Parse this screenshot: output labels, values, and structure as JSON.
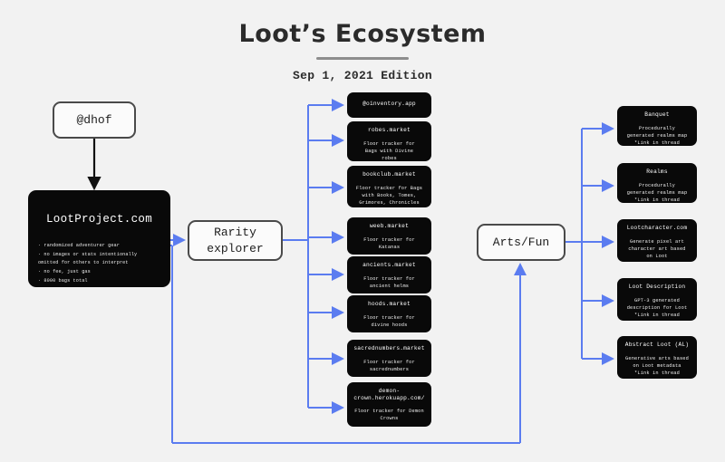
{
  "header": {
    "title": "Loot’s Ecosystem",
    "subtitle": "Sep 1, 2021 Edition"
  },
  "colors": {
    "background": "#f2f2f2",
    "node_dark": "#090909",
    "node_light": "#fbfbfb",
    "wire": "#5b7cf0",
    "arrow_black": "#111111",
    "rule": "#8d8d8d"
  },
  "nodes": {
    "author": {
      "label": "@dhof"
    },
    "loot_project": {
      "title": "LootProject.com",
      "bullets": "· randomized adventurer gear\n· no images or stats intentionally\n  omitted for others to interpret\n· no fee, just gas\n· 8000 bags total"
    },
    "rarity_explorer": {
      "label": "Rarity\nexplorer"
    },
    "arts_fun": {
      "label": "Arts/Fun"
    }
  },
  "rarity_children": [
    {
      "title": "@oinventory.app",
      "desc": ""
    },
    {
      "title": "robes.market",
      "desc": "Floor tracker for\nBags with Divine\nrobes"
    },
    {
      "title": "bookclub.market",
      "desc": "Floor tracker for Bags\nwith Books, Tomes,\nGrimores, Chronicles"
    },
    {
      "title": "weeb.market",
      "desc": "Floor tracker for\nKatanas"
    },
    {
      "title": "ancients.market",
      "desc": "Floor tracker for\nancient helms"
    },
    {
      "title": "hoods.market",
      "desc": "Floor tracker for\ndivine hoods"
    },
    {
      "title": "sacrednumbers.market",
      "desc": "Floor tracker for\nsacrednumbers"
    },
    {
      "title": "demon-\ncrown.herokuapp.com/",
      "desc": "Floor tracker for Demon\nCrowns"
    }
  ],
  "arts_children": [
    {
      "title": "Banquet",
      "desc": "Procedurally\ngenerated realms map\n*Link in thread"
    },
    {
      "title": "Realms",
      "desc": "Procedurally\ngenerated realms map\n*Link in thread"
    },
    {
      "title": "Lootcharacter.com",
      "desc": "Generate pixel art\ncharacter art based\non Loot"
    },
    {
      "title": "Loot Description",
      "desc": "GPT-3 generated\ndescription for Loot\n*Link in thread"
    },
    {
      "title": "Abstract Loot (AL)",
      "desc": "Generative arts based\non Loot metadata\n*Link in thread"
    }
  ]
}
